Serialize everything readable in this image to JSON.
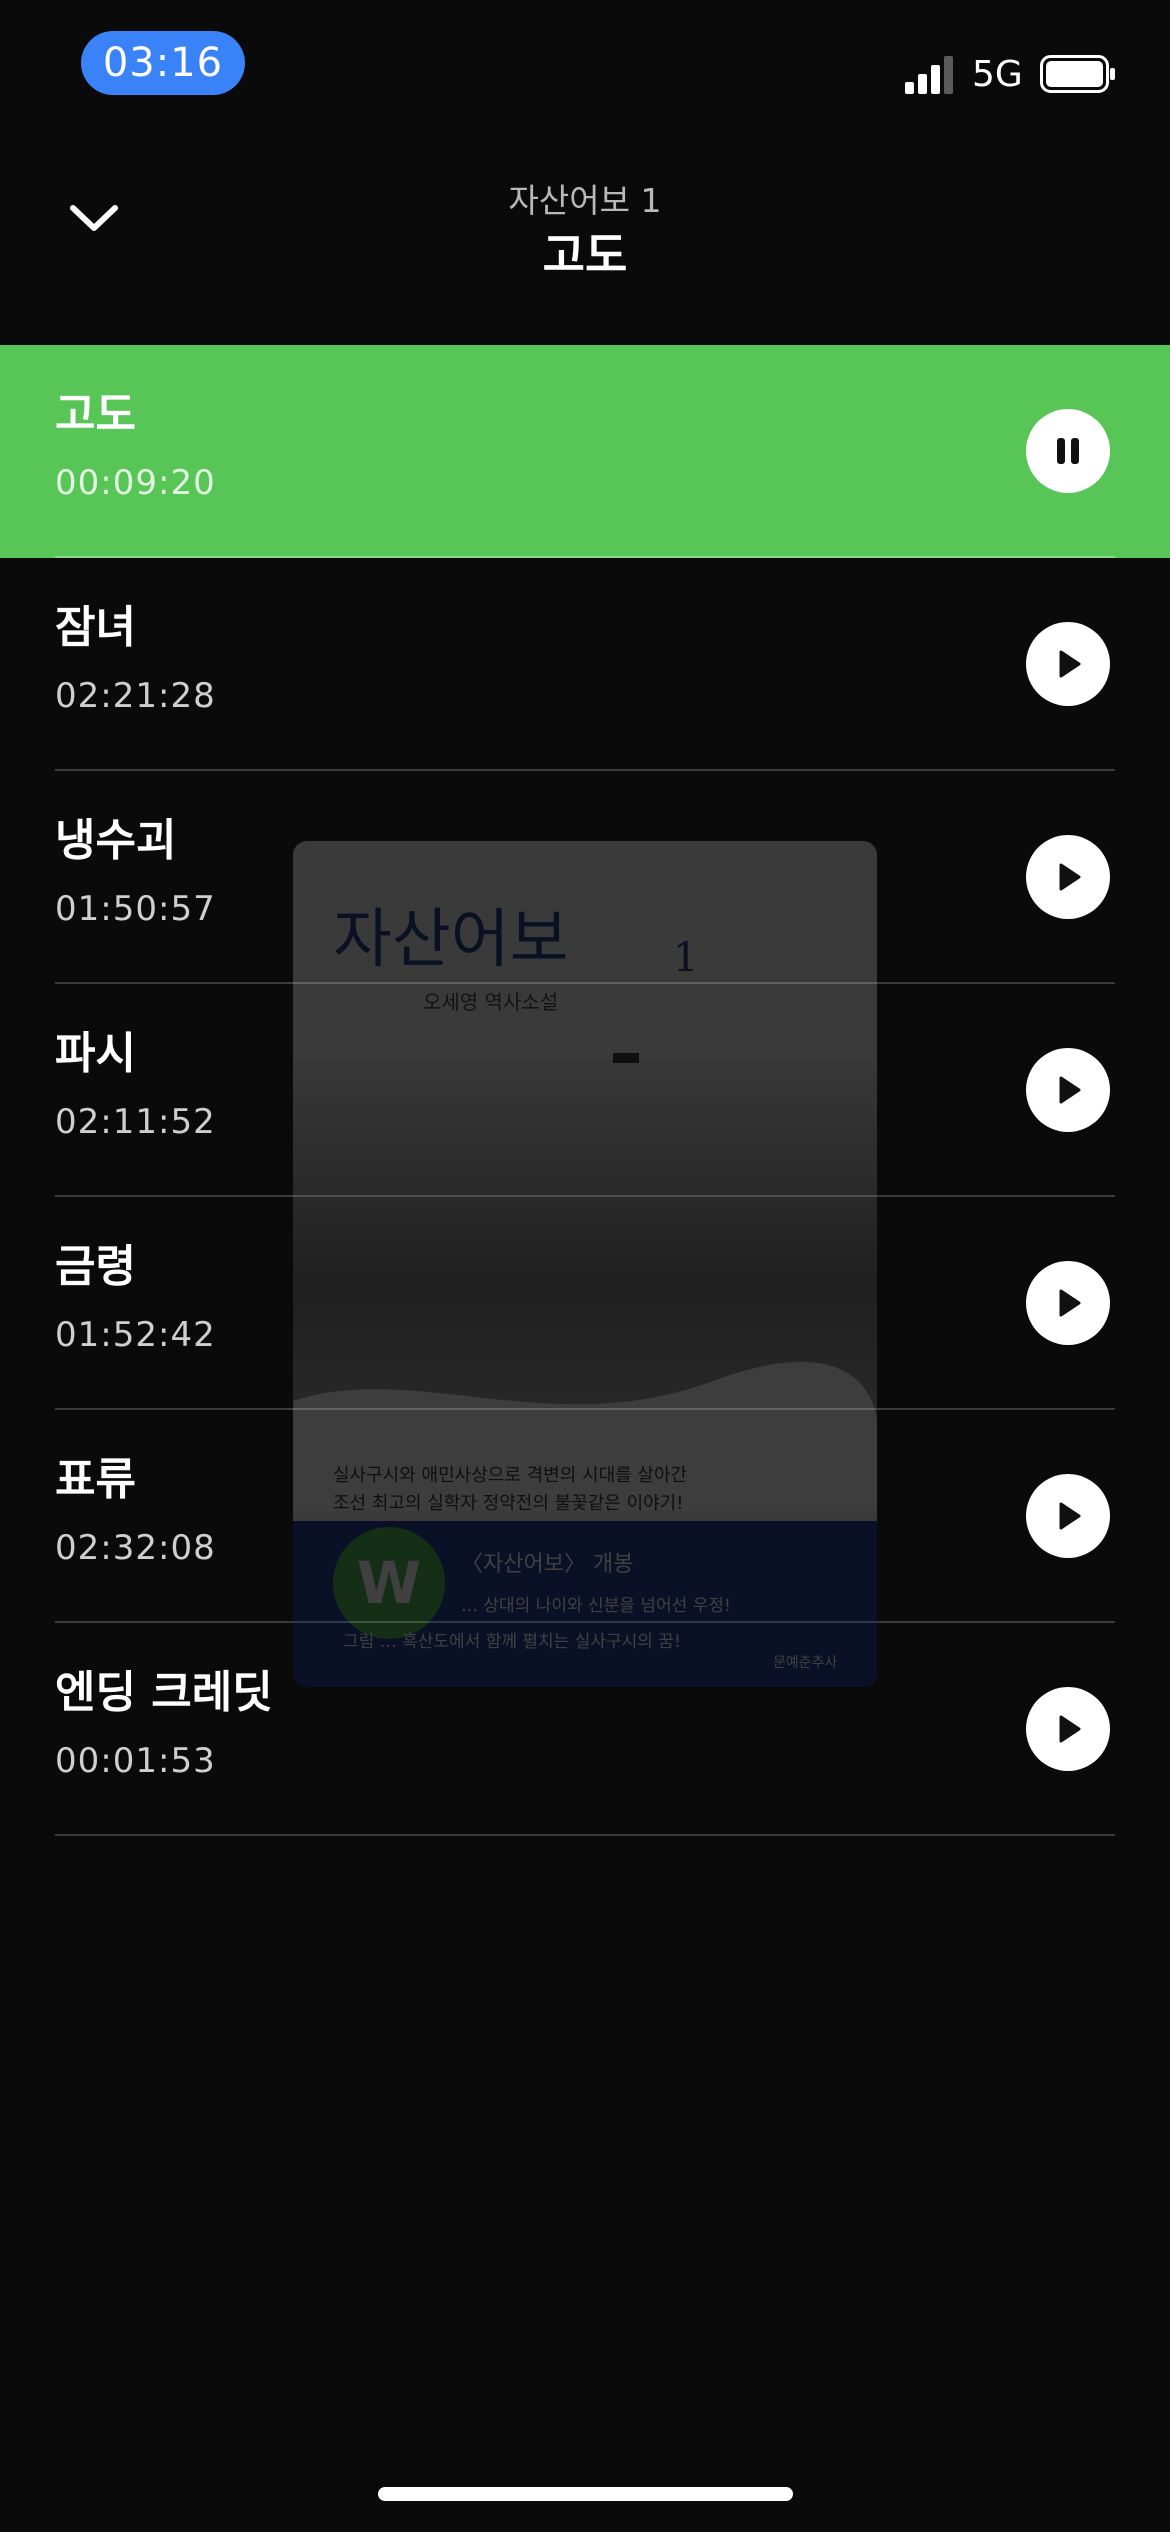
{
  "status_bar": {
    "time": "03:16",
    "network": "5G",
    "icons": [
      "signal-icon",
      "battery-icon"
    ]
  },
  "header": {
    "subtitle": "자산어보 1",
    "title": "고도",
    "collapse_icon": "chevron-down-icon"
  },
  "chapters": [
    {
      "title": "고도",
      "duration": "00:09:20",
      "state": "playing",
      "button_icon": "pause-icon"
    },
    {
      "title": "잠녀",
      "duration": "02:21:28",
      "state": "idle",
      "button_icon": "play-icon"
    },
    {
      "title": "냉수괴",
      "duration": "01:50:57",
      "state": "idle",
      "button_icon": "play-icon"
    },
    {
      "title": "파시",
      "duration": "02:11:52",
      "state": "idle",
      "button_icon": "play-icon"
    },
    {
      "title": "금령",
      "duration": "01:52:42",
      "state": "idle",
      "button_icon": "play-icon"
    },
    {
      "title": "표류",
      "duration": "02:32:08",
      "state": "idle",
      "button_icon": "play-icon"
    },
    {
      "title": "엔딩 크레딧",
      "duration": "00:01:53",
      "state": "idle",
      "button_icon": "play-icon"
    }
  ],
  "cover_art": {
    "title": "자산어보",
    "volume": "1",
    "author_line": "오세영 역사소설",
    "tagline_1": "실사구시와 애민사상으로 격변의 시대를 살아간",
    "tagline_2": "조선 최고의 실학자 정약전의 불꽃같은 이야기!",
    "banner_1": "〈자산어보〉 개봉",
    "banner_2": "… 상대의 나이와 신분을 넘어선 우정!",
    "banner_3": "그림 … 흑산도에서 함께 펼치는 실사구시의 꿈!",
    "publisher": "문예춘추사",
    "badge": "W"
  },
  "colors": {
    "background": "#0a0a0a",
    "active_row": "#58c557",
    "time_pill": "#3a82f7",
    "divider": "#3a3a3a"
  }
}
